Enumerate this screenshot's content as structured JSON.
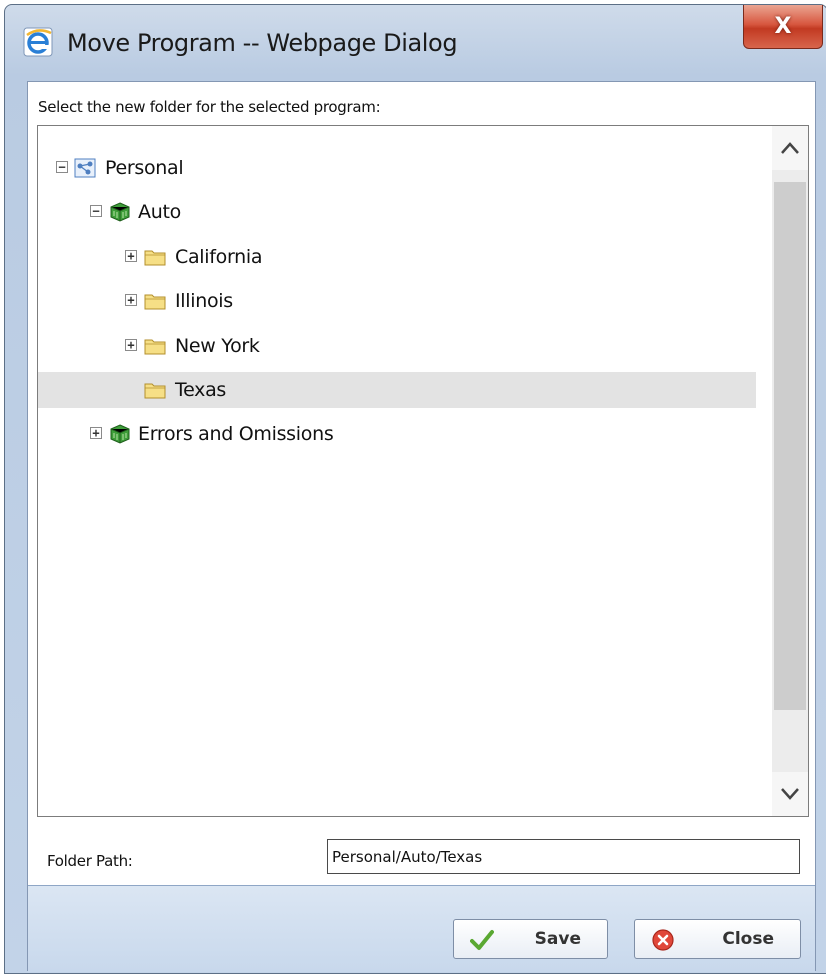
{
  "window": {
    "title": "Move Program -- Webpage Dialog",
    "close_glyph": "X",
    "title_icon": "ie-icon"
  },
  "dialog": {
    "instruction": "Select the new folder for the selected program:"
  },
  "tree": {
    "nodes": [
      {
        "label": "Personal",
        "icon": "network-icon",
        "toggle": "−",
        "level": 0,
        "selected": false
      },
      {
        "label": "Auto",
        "icon": "cube-icon",
        "toggle": "−",
        "level": 1,
        "selected": false
      },
      {
        "label": "California",
        "icon": "folder-icon",
        "toggle": "+",
        "level": 2,
        "selected": false
      },
      {
        "label": "Illinois",
        "icon": "folder-icon",
        "toggle": "+",
        "level": 2,
        "selected": false
      },
      {
        "label": "New York",
        "icon": "folder-icon",
        "toggle": "+",
        "level": 2,
        "selected": false
      },
      {
        "label": "Texas",
        "icon": "folder-icon",
        "toggle": "",
        "level": 2,
        "selected": true
      },
      {
        "label": "Errors and Omissions",
        "icon": "cube-icon",
        "toggle": "+",
        "level": 1,
        "selected": false
      }
    ]
  },
  "folder_path": {
    "label": "Folder Path:",
    "value": "Personal/Auto/Texas"
  },
  "buttons": {
    "save_label": "Save",
    "close_label": "Close"
  },
  "colors": {
    "selection": "#e3e3e3",
    "frame": "#b9cbe2",
    "close_button": "#d7573f"
  }
}
